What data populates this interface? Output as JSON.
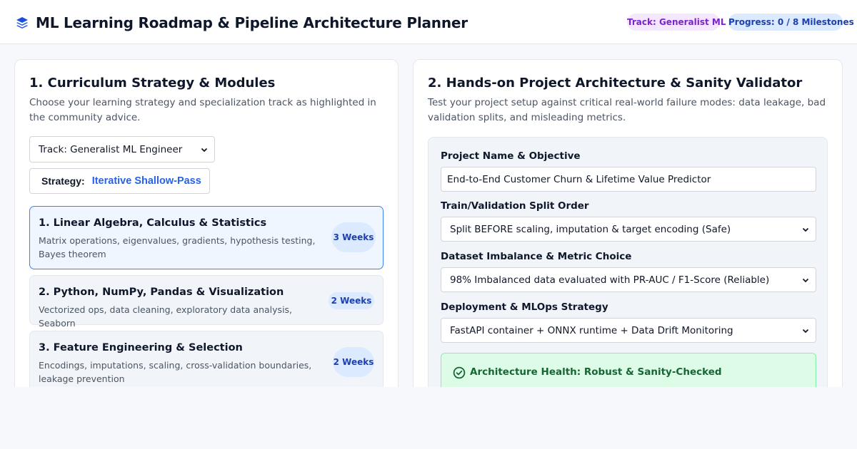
{
  "header": {
    "title": "ML Learning Roadmap & Pipeline Architecture Planner",
    "logo_icon": "layers-icon",
    "track_badge": "Track: Generalist ML",
    "progress_badge": "Progress: 0 / 8 Milestones",
    "colors": {
      "track_bg": "#f3e8ff",
      "track_text": "#7e22ce",
      "progress_bg": "#dbeafe",
      "progress_text": "#1e40af",
      "logo": "#1d4ed8"
    }
  },
  "curriculum": {
    "title": "1. Curriculum Strategy & Modules",
    "description": "Choose your learning strategy and specialization track as highlighted in the community advice.",
    "track_select": {
      "value": "Track: Generalist ML Engineer"
    },
    "strategy": {
      "label": "Strategy:",
      "value": "Iterative Shallow-Pass",
      "value_color": "#2563eb"
    },
    "modules": [
      {
        "title": "1. Linear Algebra, Calculus & Statistics",
        "description": "Matrix operations, eigenvalues, gradients, hypothesis testing, Bayes theorem",
        "duration": "3 Weeks",
        "active": true
      },
      {
        "title": "2. Python, NumPy, Pandas & Visualization",
        "description": "Vectorized ops, data cleaning, exploratory data analysis, Seaborn",
        "duration": "2 Weeks",
        "active": false
      },
      {
        "title": "3. Feature Engineering & Selection",
        "description": "Encodings, imputations, scaling, cross-validation boundaries, leakage prevention",
        "duration": "2 Weeks",
        "active": false
      }
    ]
  },
  "validator": {
    "title": "2. Hands-on Project Architecture & Sanity Validator",
    "description": "Test your project setup against critical real-world failure modes: data leakage, bad validation splits, and misleading metrics.",
    "project_name": {
      "label": "Project Name & Objective",
      "value": "End-to-End Customer Churn & Lifetime Value Predictor"
    },
    "split_order": {
      "label": "Train/Validation Split Order",
      "value": "Split BEFORE scaling, imputation & target encoding (Safe)"
    },
    "imbalance": {
      "label": "Dataset Imbalance & Metric Choice",
      "value": "98% Imbalanced data evaluated with PR-AUC / F1-Score (Reliable)"
    },
    "deployment": {
      "label": "Deployment & MLOps Strategy",
      "value": "FastAPI container + ONNX runtime + Data Drift Monitoring"
    },
    "health": {
      "icon": "check-circle-icon",
      "text": "Architecture Health: Robust & Sanity-Checked",
      "color": "#166534"
    }
  }
}
